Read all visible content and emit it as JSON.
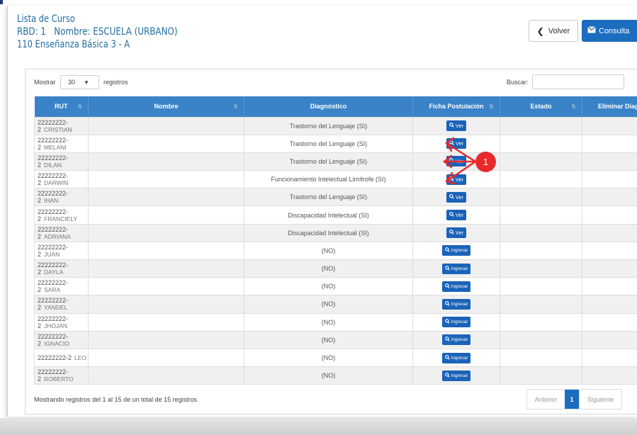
{
  "header": {
    "title": "Lista de Curso",
    "school": "RBD: 1   Nombre: ESCUELA (URBANO)",
    "course": "110 Enseñanza Básica 3 - A"
  },
  "actions": {
    "back_label": "Volver",
    "query_label": "Consulta"
  },
  "table_controls": {
    "show_label": "Mostrar",
    "page_size": "30",
    "records_label": "registros",
    "search_label": "Buscar:",
    "search_value": ""
  },
  "columns": [
    "RUT",
    "Nombre",
    "Diagnóstico",
    "Ficha Postulación",
    "Estado",
    "Eliminar Diag."
  ],
  "rows": [
    {
      "rut": "22222222-2",
      "name": "CRISTIAN",
      "diag": "Trastorno del Lenguaje (SI)",
      "action": "Ver",
      "estado": "",
      "eliminar": ""
    },
    {
      "rut": "22222222-2",
      "name": "MELANI",
      "diag": "Trastorno del Lenguaje (SI)",
      "action": "Ver",
      "estado": "",
      "eliminar": ""
    },
    {
      "rut": "22222222-2",
      "name": "DILAN",
      "diag": "Trastorno del Lenguaje (SI)",
      "action": "Ver",
      "estado": "",
      "eliminar": ""
    },
    {
      "rut": "22222222-2",
      "name": "DARWIN",
      "diag": "Funcionamiento Intelectual Limítrofe (SI)",
      "action": "Ver",
      "estado": "",
      "eliminar": ""
    },
    {
      "rut": "22222222-2",
      "name": "IHAN",
      "diag": "Trastorno del Lenguaje (SI)",
      "action": "Ver",
      "estado": "",
      "eliminar": ""
    },
    {
      "rut": "22222222-2",
      "name": "FRANCIELY",
      "diag": "Discapacidad Intelectual (SI)",
      "action": "Ver",
      "estado": "",
      "eliminar": ""
    },
    {
      "rut": "22222222-2",
      "name": "ADRIANA",
      "diag": "Discapacidad Intelectual (SI)",
      "action": "Ver",
      "estado": "",
      "eliminar": ""
    },
    {
      "rut": "22222222-2",
      "name": "JUAN",
      "diag": "(NO)",
      "action": "Ingresar",
      "estado": "",
      "eliminar": ""
    },
    {
      "rut": "22222222-2",
      "name": "DAYLA",
      "diag": "(NO)",
      "action": "Ingresar",
      "estado": "",
      "eliminar": ""
    },
    {
      "rut": "22222222-2",
      "name": "SARA",
      "diag": "(NO)",
      "action": "Ingresar",
      "estado": "",
      "eliminar": ""
    },
    {
      "rut": "22222222-2",
      "name": "YANDEL",
      "diag": "(NO)",
      "action": "Ingresar",
      "estado": "",
      "eliminar": ""
    },
    {
      "rut": "22222222-2",
      "name": "JHOJAN",
      "diag": "(NO)",
      "action": "Ingresar",
      "estado": "",
      "eliminar": ""
    },
    {
      "rut": "22222222-2",
      "name": "IGNACIO",
      "diag": "(NO)",
      "action": "Ingresar",
      "estado": "",
      "eliminar": ""
    },
    {
      "rut": "22222222-2",
      "name": "LEO",
      "diag": "(NO)",
      "action": "Ingresar",
      "estado": "",
      "eliminar": ""
    },
    {
      "rut": "22222222-2",
      "name": "ROBERTO",
      "diag": "(NO)",
      "action": "Ingresar",
      "estado": "",
      "eliminar": ""
    }
  ],
  "footer": {
    "info": "Mostrando registros del 1 al 15 de un total de 15 registros",
    "prev_label": "Anterior",
    "current_page": "1",
    "next_label": "Siguiente"
  },
  "annotation": {
    "number": "1",
    "color": "#e8282b"
  },
  "colors": {
    "header_text": "#1f6d9f",
    "table_header": "#3a83c8",
    "button_blue": "#1a63b9"
  },
  "icons": {
    "back": "chevron-left-icon",
    "query": "envelope-icon",
    "select": "chevron-down-icon",
    "ver": "search-icon",
    "ingresar": "search-icon",
    "sort": "sort-icon"
  }
}
